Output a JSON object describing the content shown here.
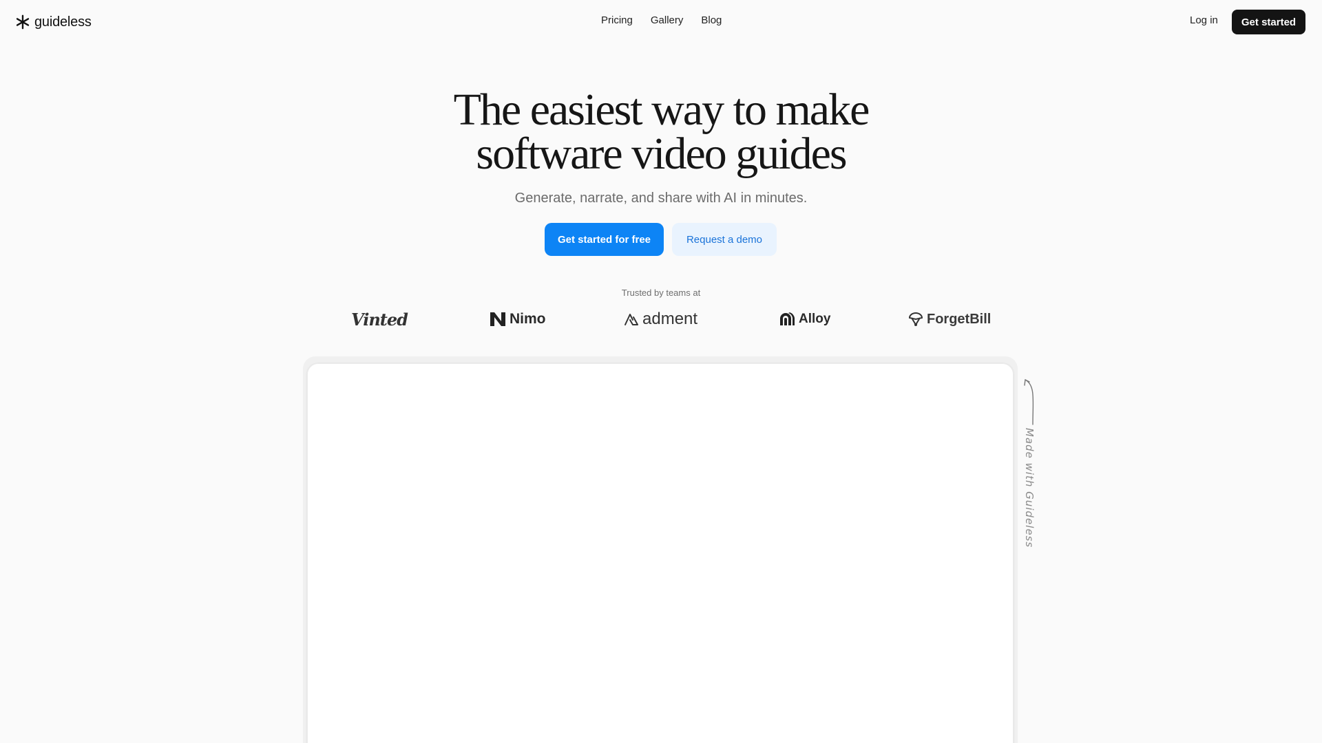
{
  "header": {
    "logo_text": "guideless",
    "nav": [
      "Pricing",
      "Gallery",
      "Blog"
    ],
    "login": "Log in",
    "cta": "Get started"
  },
  "hero": {
    "title_line1": "The easiest way to make",
    "title_line2": "software video guides",
    "subtitle": "Generate, narrate, and share with AI in minutes.",
    "primary_cta": "Get started for free",
    "secondary_cta": "Request a demo"
  },
  "trusted": {
    "label": "Trusted by teams at",
    "brands": [
      "Vinted",
      "Nimo",
      "adment",
      "Alloy",
      "ForgetBill"
    ]
  },
  "annotation": "Made with Guideless",
  "colors": {
    "primary": "#0d84f5",
    "secondary_bg": "#e9f3fe",
    "dark_button": "#141414",
    "background": "#fafafa"
  },
  "icons": [
    "asterisk-logo-icon",
    "nimo-logo-icon",
    "adment-logo-icon",
    "alloy-logo-icon",
    "forgetbill-logo-icon",
    "curved-arrow-icon"
  ]
}
